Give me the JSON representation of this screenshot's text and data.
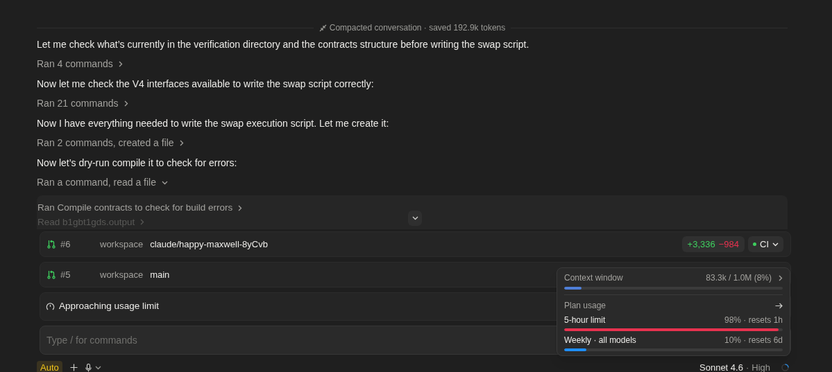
{
  "compaction_note": "Compacted conversation · saved 192.9k tokens",
  "messages": [
    {
      "kind": "text",
      "text": "Let me check what’s currently in the verification directory and the contracts structure before writing the swap script."
    },
    {
      "kind": "tool",
      "text": "Ran 4 commands",
      "expanded": false
    },
    {
      "kind": "text",
      "text": "Now let me check the V4 interfaces available to write the swap script correctly:"
    },
    {
      "kind": "tool",
      "text": "Ran 21 commands",
      "expanded": false
    },
    {
      "kind": "text",
      "text": "Now I have everything needed to write the swap execution script. Let me create it:"
    },
    {
      "kind": "tool",
      "text": "Ran 2 commands, created a file",
      "expanded": false
    },
    {
      "kind": "text",
      "text": "Now let’s dry-run compile it to check for errors:"
    },
    {
      "kind": "tool",
      "text": "Ran a command, read a file",
      "expanded": true,
      "children": [
        {
          "text": "Ran Compile contracts to check for build errors"
        },
        {
          "text": "Read b1gbt1gds.output"
        }
      ]
    }
  ],
  "pull_requests": [
    {
      "number": "#6",
      "label": "workspace",
      "branch": "claude/happy-maxwell-8yCvb",
      "additions": "+3,336",
      "deletions": "−984",
      "ci": "CI"
    },
    {
      "number": "#5",
      "label": "workspace",
      "branch": "main"
    }
  ],
  "usage_notice": "Approaching usage limit",
  "input": {
    "placeholder": "Type / for commands"
  },
  "toolbar": {
    "mode": "Auto",
    "model": "Sonnet 4.6",
    "separator": "·",
    "effort": "High"
  },
  "usage_popover": {
    "context": {
      "label": "Context window",
      "reading": "83.3k / 1.0M (8%)",
      "level": 0.08
    },
    "plan_label": "Plan usage",
    "limits": [
      {
        "label": "5-hour limit",
        "reading": "98% · resets 1h",
        "level": 0.98,
        "color": "#e8324f"
      },
      {
        "label": "Weekly · all models",
        "reading": "10% · resets 6d",
        "level": 0.1,
        "color": "#1e8fff"
      }
    ]
  }
}
